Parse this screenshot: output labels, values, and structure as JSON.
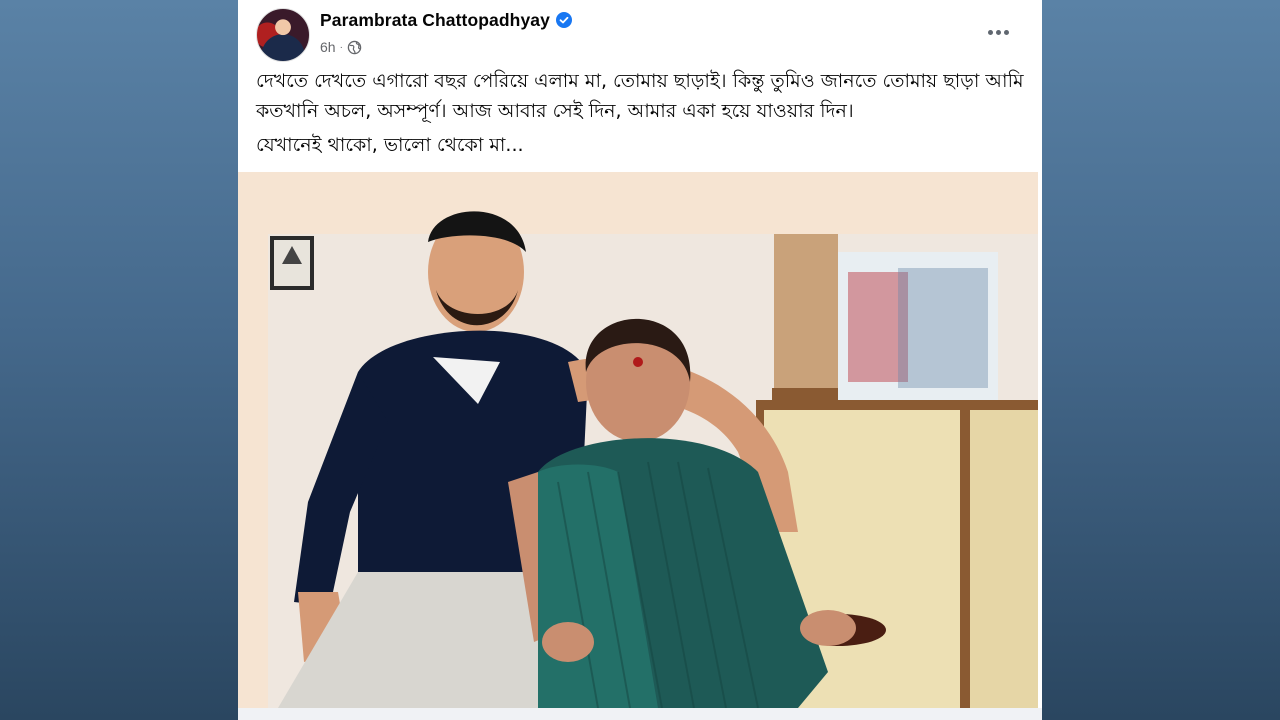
{
  "post": {
    "author": "Parambrata Chattopadhyay",
    "time": "6h",
    "privacy_icon": "globe-icon",
    "verified_icon": "verified-badge-icon",
    "more_icon": "more-options-icon",
    "text_line_1": "দেখতে দেখতে এগারো বছর পেরিয়ে এলাম মা, তোমায় ছাড়াই। কিন্তু তুমিও জানতে তোমায় ছাড়া আমি কতখানি অচল, অসম্পূর্ণ। আজ আবার সেই দিন, আমার একা হয়ে যাওয়ার দিন।",
    "text_line_2": "যেখানেই থাকো, ভালো থেকো মা...",
    "accent_color": "#1877f2"
  }
}
